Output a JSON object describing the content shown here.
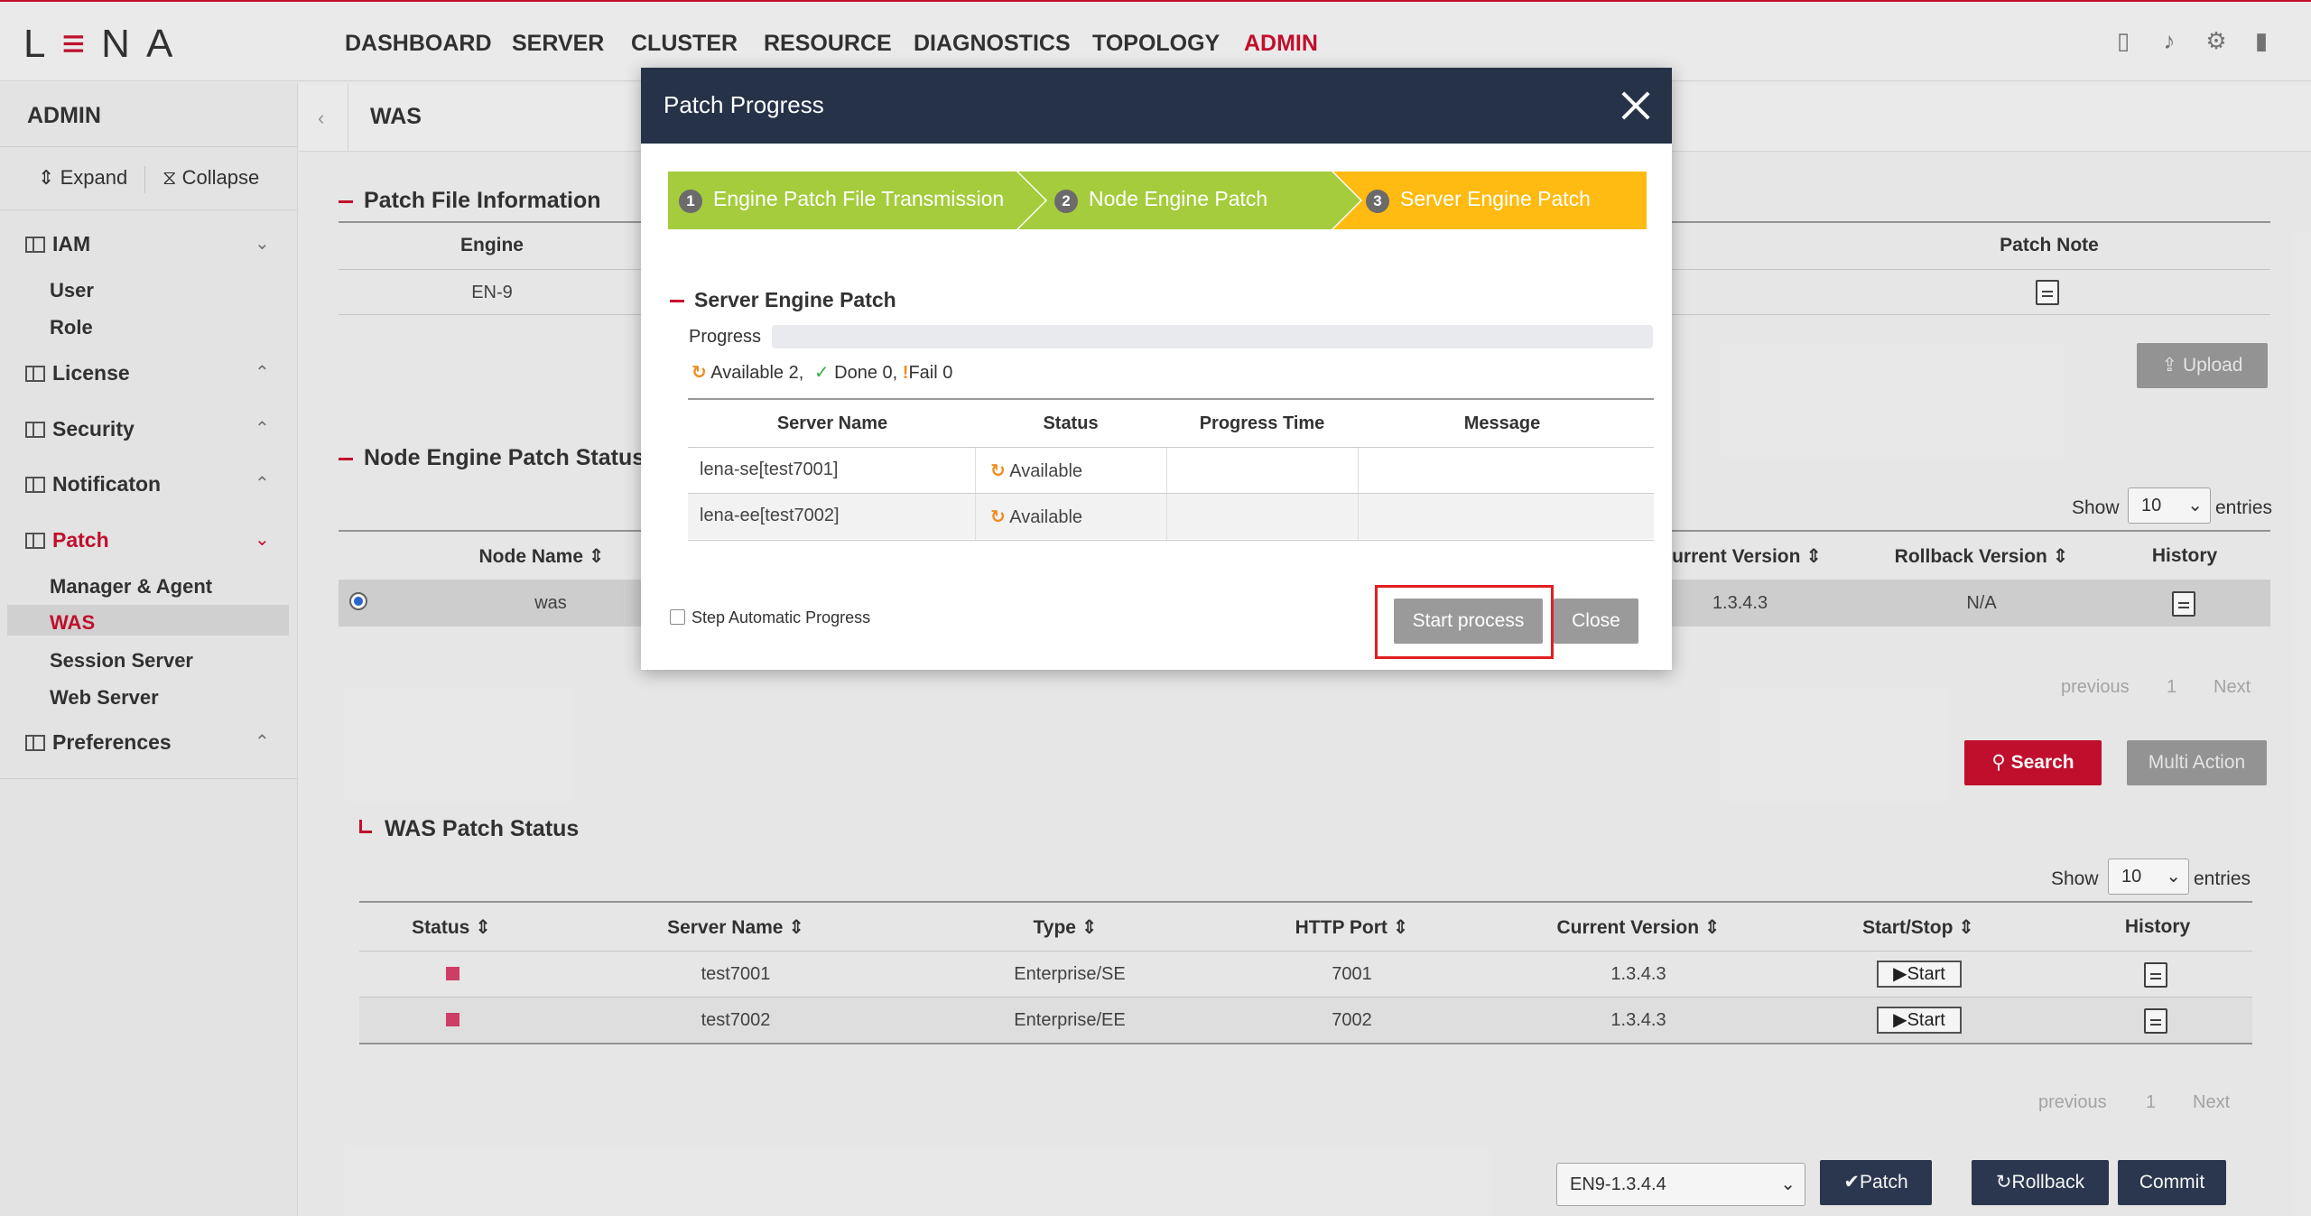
{
  "app": {
    "logo": "LENA",
    "nav": [
      "DASHBOARD",
      "SERVER",
      "CLUSTER",
      "RESOURCE",
      "DIAGNOSTICS",
      "TOPOLOGY",
      "ADMIN"
    ],
    "active_nav": "ADMIN",
    "icons": [
      "help-icon",
      "bell-icon",
      "gear-icon",
      "logout-icon"
    ]
  },
  "sidebar": {
    "title": "ADMIN",
    "expand_label": "Expand",
    "collapse_label": "Collapse",
    "groups": [
      {
        "label": "IAM",
        "items": [
          "User",
          "Role"
        ]
      },
      {
        "label": "License",
        "items": []
      },
      {
        "label": "Security",
        "items": []
      },
      {
        "label": "Notificaton",
        "items": []
      },
      {
        "label": "Patch",
        "items": [
          "Manager & Agent",
          "WAS",
          "Session Server",
          "Web Server"
        ]
      },
      {
        "label": "Preferences",
        "items": []
      }
    ],
    "active_item": "WAS"
  },
  "main": {
    "page_title": "WAS",
    "patch_file": {
      "title": "Patch File Information",
      "col_engine": "Engine",
      "col_patch_note": "Patch Note",
      "engine_value": "EN-9",
      "upload_label": "Upload"
    },
    "node_status": {
      "title": "Node Engine Patch Status",
      "show_label": "Show",
      "entries_label": "entries",
      "page_size": "10",
      "columns": [
        "Node Name",
        "urrent Version",
        "Rollback Version",
        "History"
      ],
      "row": {
        "node_name": "was",
        "current_version": "1.3.4.3",
        "rollback_version": "N/A"
      },
      "pager": {
        "previous": "previous",
        "page": "1",
        "next": "Next"
      },
      "search_label": "Search",
      "multi_action_label": "Multi Action"
    },
    "was_status": {
      "title": "WAS Patch Status",
      "show_label": "Show",
      "entries_label": "entries",
      "page_size": "10",
      "columns": [
        "Status",
        "Server Name",
        "Type",
        "HTTP Port",
        "Current Version",
        "Start/Stop",
        "History"
      ],
      "rows": [
        {
          "server": "test7001",
          "type": "Enterprise/SE",
          "port": "7001",
          "version": "1.3.4.3",
          "action": "Start"
        },
        {
          "server": "test7002",
          "type": "Enterprise/EE",
          "port": "7002",
          "version": "1.3.4.3",
          "action": "Start"
        }
      ],
      "pager": {
        "previous": "previous",
        "page": "1",
        "next": "Next"
      },
      "version_select": "EN9-1.3.4.4",
      "patch_label": "Patch",
      "rollback_label": "Rollback",
      "commit_label": "Commit"
    }
  },
  "modal": {
    "title": "Patch Progress",
    "steps": [
      {
        "num": "1",
        "label": "Engine Patch File Transmission"
      },
      {
        "num": "2",
        "label": "Node Engine Patch"
      },
      {
        "num": "3",
        "label": "Server Engine Patch"
      }
    ],
    "step_colors": {
      "done": "#a4cc3c",
      "active": "#ffbb12"
    },
    "section_title": "Server Engine Patch",
    "progress_label": "Progress",
    "progress_value": 0,
    "summary": {
      "available": "Available 2,",
      "done": "Done 0,",
      "fail": "Fail 0"
    },
    "columns": [
      "Server Name",
      "Status",
      "Progress Time",
      "Message"
    ],
    "rows": [
      {
        "server": "lena-se[test7001]",
        "status": "Available"
      },
      {
        "server": "lena-ee[test7002]",
        "status": "Available"
      }
    ],
    "step_auto_label": "Step Automatic Progress",
    "start_label": "Start process",
    "close_label": "Close"
  }
}
